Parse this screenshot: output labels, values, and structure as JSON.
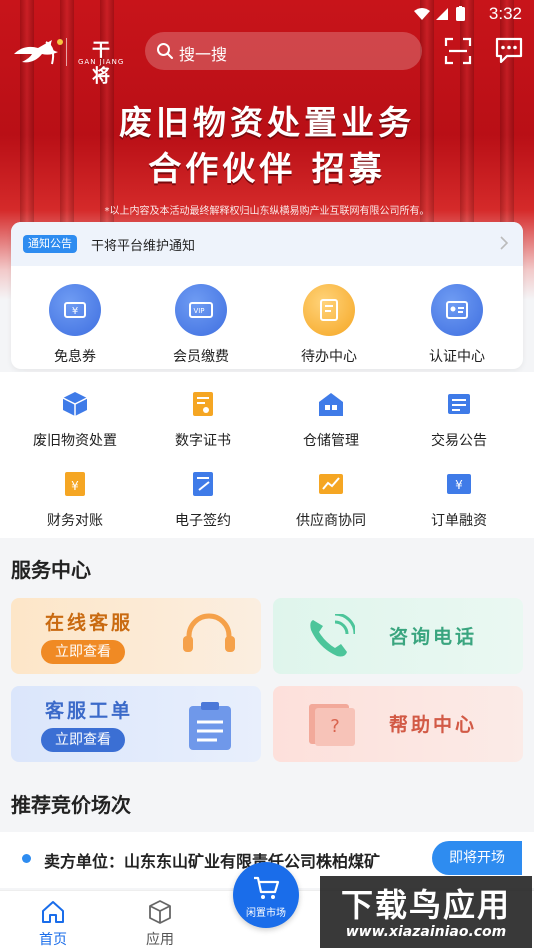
{
  "status": {
    "time": "3:32"
  },
  "header": {
    "logo_text": "干将",
    "logo_sub": "GAN JIANG",
    "search_placeholder": "搜一搜"
  },
  "banner": {
    "line1": "废旧物资处置业务",
    "line2": "合作伙伴 招募",
    "disclaimer": "*以上内容及本活动最终解释权归山东纵横易购产业互联网有限公司所有。"
  },
  "notice": {
    "badge": "通知公告",
    "text": "干将平台维护通知"
  },
  "quick": [
    {
      "label": "免息券",
      "icon": "coupon-icon",
      "color": "#3f7be8"
    },
    {
      "label": "会员缴费",
      "icon": "vip-card-icon",
      "color": "#3f7be8"
    },
    {
      "label": "待办中心",
      "icon": "todo-icon",
      "color": "#f5a623"
    },
    {
      "label": "认证中心",
      "icon": "id-card-icon",
      "color": "#3f7be8"
    }
  ],
  "grid": [
    {
      "label": "废旧物资处置",
      "icon": "box-icon",
      "color": "#3f7be8"
    },
    {
      "label": "数字证书",
      "icon": "certificate-icon",
      "color": "#f5a623"
    },
    {
      "label": "仓储管理",
      "icon": "warehouse-icon",
      "color": "#3f7be8"
    },
    {
      "label": "交易公告",
      "icon": "announcement-icon",
      "color": "#3f7be8"
    },
    {
      "label": "财务对账",
      "icon": "finance-icon",
      "color": "#f5a623"
    },
    {
      "label": "电子签约",
      "icon": "e-sign-icon",
      "color": "#3f7be8"
    },
    {
      "label": "供应商协同",
      "icon": "chart-icon",
      "color": "#f5a623"
    },
    {
      "label": "订单融资",
      "icon": "yen-icon",
      "color": "#3f7be8"
    }
  ],
  "service": {
    "title": "服务中心",
    "online": {
      "title": "在线客服",
      "button": "立即查看"
    },
    "phone": {
      "title": "咨询电话"
    },
    "ticket": {
      "title": "客服工单",
      "button": "立即查看"
    },
    "help": {
      "title": "帮助中心"
    }
  },
  "auction": {
    "title": "推荐竞价场次",
    "seller": "卖方单位：山东东山矿业有限责任公司株柏煤矿",
    "status": "即将开场"
  },
  "nav": {
    "home": "首页",
    "apps": "应用",
    "market": "闲置市场",
    "home_color": "#1a6dea"
  },
  "watermark": {
    "big": "下载鸟应用",
    "small": "www.xiazainiao.com"
  }
}
